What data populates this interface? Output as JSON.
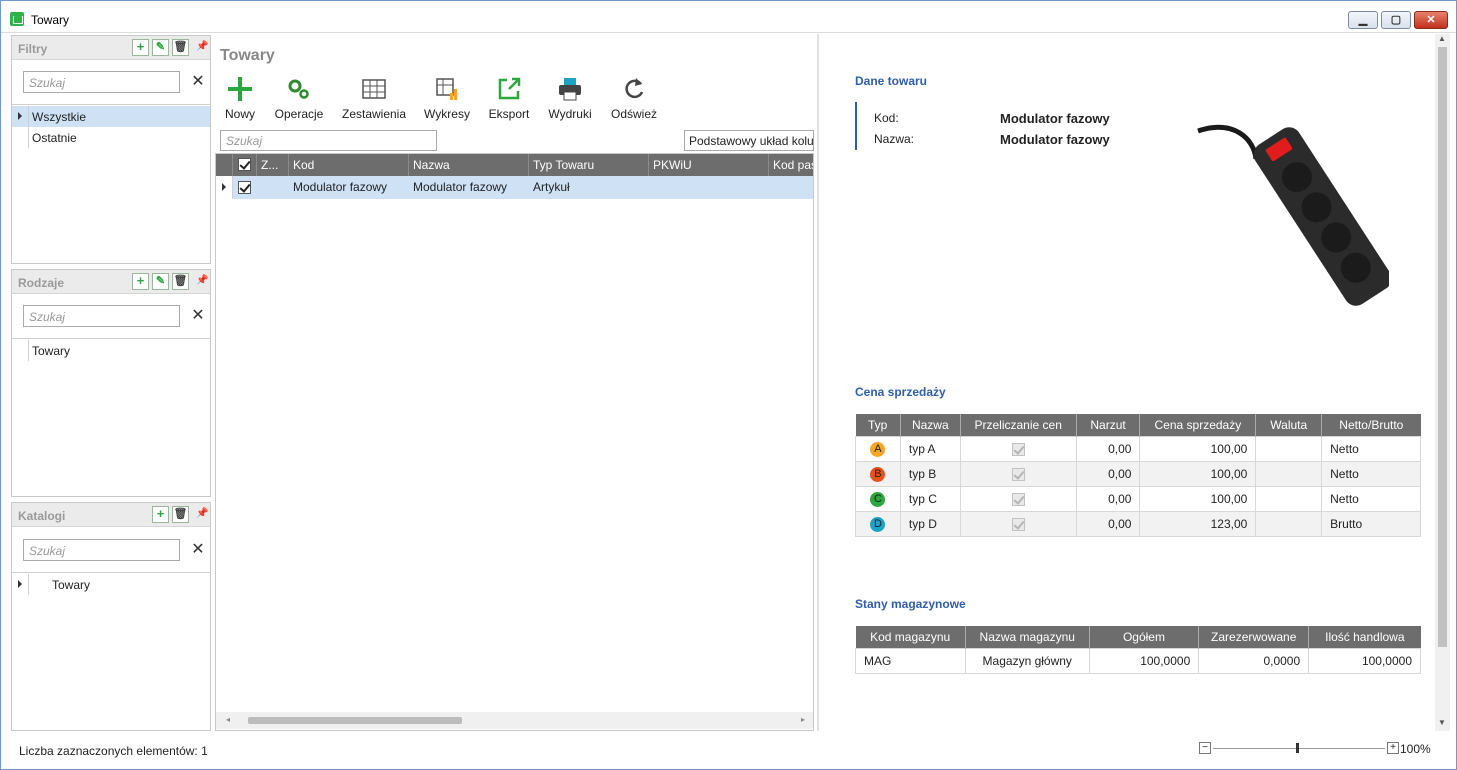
{
  "window": {
    "title": "Towary"
  },
  "panels": {
    "filtry": {
      "title": "Filtry",
      "search_placeholder": "Szukaj",
      "items": [
        "Wszystkie",
        "Ostatnie"
      ]
    },
    "rodzaje": {
      "title": "Rodzaje",
      "search_placeholder": "Szukaj",
      "items": [
        "Towary"
      ]
    },
    "katalogi": {
      "title": "Katalogi",
      "search_placeholder": "Szukaj",
      "items": [
        "Towary"
      ]
    }
  },
  "main": {
    "heading": "Towary",
    "toolbar": [
      "Nowy",
      "Operacje",
      "Zestawienia",
      "Wykresy",
      "Eksport",
      "Wydruki",
      "Odśwież"
    ],
    "search_placeholder": "Szukaj",
    "layout_select": "Podstawowy układ kolumn",
    "columns": [
      "Z...",
      "Kod",
      "Nazwa",
      "Typ Towaru",
      "PKWiU",
      "Kod pas"
    ],
    "rows": [
      {
        "kod": "Modulator fazowy",
        "nazwa": "Modulator fazowy",
        "typ": "Artykuł"
      }
    ]
  },
  "detail": {
    "dane_title": "Dane towaru",
    "kod_label": "Kod:",
    "kod_value": "Modulator fazowy",
    "nazwa_label": "Nazwa:",
    "nazwa_value": "Modulator fazowy",
    "cena_title": "Cena sprzedaży",
    "cena_columns": [
      "Typ",
      "Nazwa",
      "Przeliczanie cen",
      "Narzut",
      "Cena sprzedaży",
      "Waluta",
      "Netto/Brutto"
    ],
    "cena_rows": [
      {
        "badge": "A",
        "color": "#f5a623",
        "nazwa": "typ A",
        "narzut": "0,00",
        "cena": "100,00",
        "waluta": "",
        "nb": "Netto"
      },
      {
        "badge": "B",
        "color": "#e8501e",
        "nazwa": "typ B",
        "narzut": "0,00",
        "cena": "100,00",
        "waluta": "",
        "nb": "Netto"
      },
      {
        "badge": "C",
        "color": "#2aa83d",
        "nazwa": "typ C",
        "narzut": "0,00",
        "cena": "100,00",
        "waluta": "",
        "nb": "Netto"
      },
      {
        "badge": "D",
        "color": "#1ba3c6",
        "nazwa": "typ D",
        "narzut": "0,00",
        "cena": "123,00",
        "waluta": "",
        "nb": "Brutto"
      }
    ],
    "stany_title": "Stany magazynowe",
    "stany_columns": [
      "Kod magazynu",
      "Nazwa magazynu",
      "Ogółem",
      "Zarezerwowane",
      "Ilość handlowa"
    ],
    "stany_rows": [
      {
        "kod": "MAG",
        "nazwa": "Magazyn główny",
        "ogolem": "100,0000",
        "zarez": "0,0000",
        "ilosc": "100,0000"
      }
    ]
  },
  "status": {
    "selected_text": "Liczba zaznaczonych elementów: 1",
    "zoom": "100%"
  }
}
